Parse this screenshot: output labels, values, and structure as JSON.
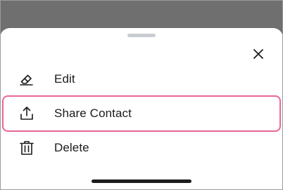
{
  "sheet": {
    "close_icon": "close-icon",
    "actions": [
      {
        "label": "Edit",
        "icon": "pencil-eraser-icon"
      },
      {
        "label": "Share Contact",
        "icon": "share-upload-icon",
        "highlight_color": "#e8669a"
      },
      {
        "label": "Delete",
        "icon": "trash-icon"
      }
    ]
  }
}
